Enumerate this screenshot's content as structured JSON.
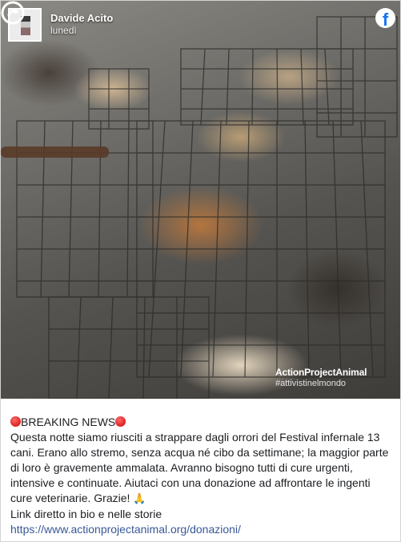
{
  "post": {
    "author": "Davide Acito",
    "date": "lunedì",
    "social_icon": "facebook-icon",
    "photo": {
      "watermark_brand": "ActionProjectAnimal",
      "watermark_tag": "#attivistinelmondo"
    },
    "caption": {
      "headline": "BREAKING NEWS",
      "body": "Questa notte siamo riusciti a strappare dagli orrori del Festival infernale 13 cani. Erano allo stremo, senza acqua né cibo da settimane; la maggior parte di loro è gravemente ammalata. Avranno bisogno tutti di cure urgenti, intensive e continuate. Aiutaci con una donazione ad affrontare le ingenti cure veterinarie. Grazie!",
      "body_emoji": "🙏",
      "link_note": "Link diretto in bio e nelle storie",
      "url": "https://www.actionprojectanimal.org/donazioni/"
    }
  },
  "colors": {
    "facebook_blue": "#1877f2",
    "link": "#385898",
    "text": "#1c1e21",
    "red_dot": "#dd1f1f"
  }
}
